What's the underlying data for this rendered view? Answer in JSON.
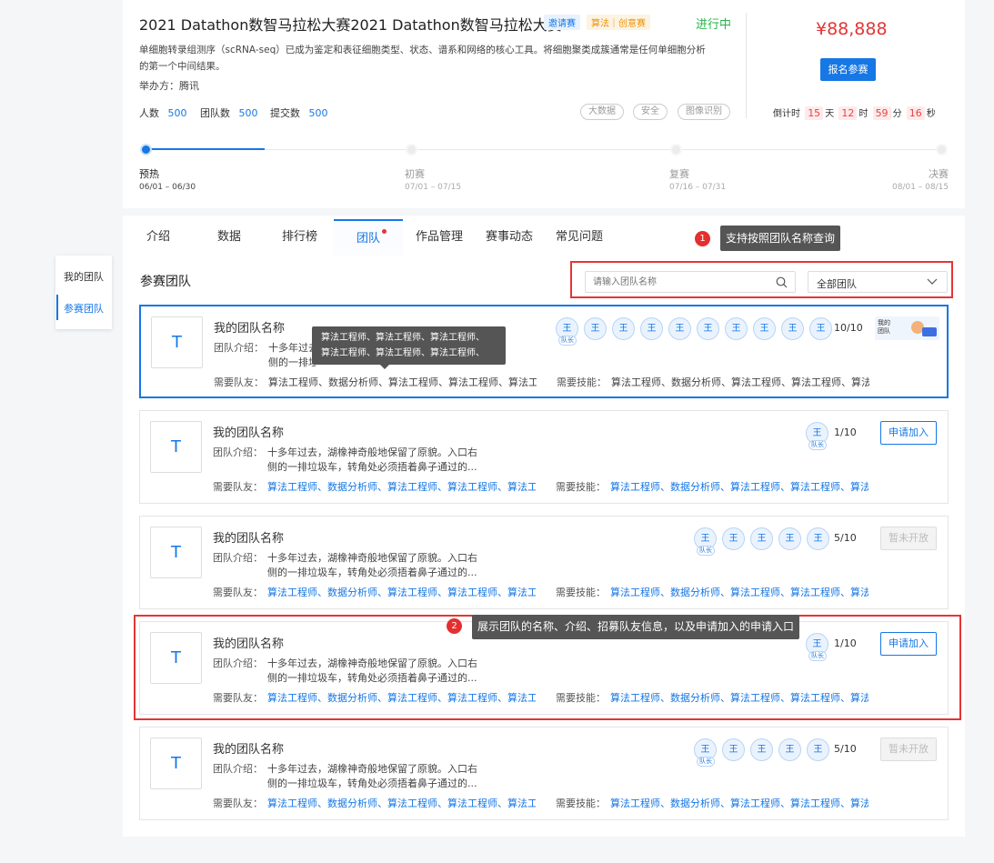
{
  "competition": {
    "title": "2021 Datathon数智马拉松大赛2021 Datathon数智马拉松大赛",
    "tag_invite": "邀请赛",
    "tag_type": "算法｜创意赛",
    "status": "进行中",
    "description_line1": "单细胞转录组测序（scRNA-seq）已成为鉴定和表征细胞类型、状态、谱系和网络的核心工具。将细胞聚类成簇通常是任何单细胞分析",
    "description_line2": "的第一个中间结果。",
    "organizer": "举办方：腾讯",
    "stats": [
      {
        "label": "人数",
        "value": "500"
      },
      {
        "label": "团队数",
        "value": "500"
      },
      {
        "label": "提交数",
        "value": "500"
      }
    ],
    "pills": [
      "大数据",
      "安全",
      "图像识别"
    ],
    "prize": "¥88,888",
    "signup_label": "报名参赛",
    "countdown": {
      "prefix": "倒计时",
      "days": "15",
      "days_unit": "天",
      "hours": "12",
      "hours_unit": "时",
      "minutes": "59",
      "minutes_unit": "分",
      "seconds": "16",
      "seconds_unit": "秒"
    },
    "progress": 0.2,
    "stages": [
      {
        "name": "预热",
        "date": "06/01 – 06/30"
      },
      {
        "name": "初赛",
        "date": "07/01 – 07/15"
      },
      {
        "name": "复赛",
        "date": "07/16 – 07/31"
      },
      {
        "name": "决赛",
        "date": "08/01 – 08/15"
      }
    ]
  },
  "tabs": [
    "介绍",
    "数据",
    "排行榜",
    "团队",
    "作品管理",
    "赛事动态",
    "常见问题"
  ],
  "active_tab": "团队",
  "side_menu": [
    "我的团队",
    "参赛团队"
  ],
  "section_title": "参赛团队",
  "search": {
    "placeholder": "请输入团队名称"
  },
  "filter": {
    "value": "全部团队"
  },
  "annotations": [
    {
      "num": "1",
      "text": "支持按照团队名称查询"
    },
    {
      "num": "2",
      "text": "展示团队的名称、介绍、招募队友信息，以及申请加入的申请入口"
    }
  ],
  "tooltip": {
    "line1": "算法工程师、算法工程师、算法工程师、",
    "line2": "算法工程师、算法工程师、算法工程师、"
  },
  "member_char": "王",
  "leader_label": "队长",
  "banner_text": "我的团队",
  "labels": {
    "intro": "团队介绍：",
    "need": "需要队友：",
    "skill": "需要技能："
  },
  "teams": [
    {
      "logo": "T",
      "name": "我的团队名称",
      "intro1": "十多年过去，湖橡神奇般地保留了原貌。入口右",
      "intro2": "侧的一排垃圾车，转角处必须捂着鼻子通过的...",
      "need": "算法工程师、数据分析师、算法工程师、算法工程师、算法工程师",
      "skill": "算法工程师、数据分析师、算法工程师、算法工程师、算法工程师",
      "count": "10/10",
      "action": ""
    },
    {
      "logo": "T",
      "name": "我的团队名称",
      "intro1": "十多年过去，湖橡神奇般地保留了原貌。入口右",
      "intro2": "侧的一排垃圾车，转角处必须捂着鼻子通过的...",
      "need": "算法工程师、数据分析师、算法工程师、算法工程师、算法工程师",
      "skill": "算法工程师、数据分析师、算法工程师、算法工程师、算法工程师",
      "count": "1/10",
      "action": "申请加入"
    },
    {
      "logo": "T",
      "name": "我的团队名称",
      "intro1": "十多年过去，湖橡神奇般地保留了原貌。入口右",
      "intro2": "侧的一排垃圾车，转角处必须捂着鼻子通过的...",
      "need": "算法工程师、数据分析师、算法工程师、算法工程师、算法工程师",
      "skill": "算法工程师、数据分析师、算法工程师、算法工程师、算法工程师",
      "count": "5/10",
      "action": "暂未开放"
    },
    {
      "logo": "T",
      "name": "我的团队名称",
      "intro1": "十多年过去，湖橡神奇般地保留了原貌。入口右",
      "intro2": "侧的一排垃圾车，转角处必须捂着鼻子通过的...",
      "need": "算法工程师、数据分析师、算法工程师、算法工程师、算法工程师",
      "skill": "算法工程师、数据分析师、算法工程师、算法工程师、算法工程师",
      "count": "1/10",
      "action": "申请加入"
    },
    {
      "logo": "T",
      "name": "我的团队名称",
      "intro1": "十多年过去，湖橡神奇般地保留了原貌。入口右",
      "intro2": "侧的一排垃圾车，转角处必须捂着鼻子通过的...",
      "need": "算法工程师、数据分析师、算法工程师、算法工程师、算法工程师",
      "skill": "算法工程师、数据分析师、算法工程师、算法工程师、算法工程师",
      "count": "5/10",
      "action": "暂未开放"
    }
  ],
  "colors": {
    "accent": "#1677e5",
    "status_green": "#2bb24c",
    "price_red": "#e53535",
    "annotation_red": "#e53535"
  }
}
